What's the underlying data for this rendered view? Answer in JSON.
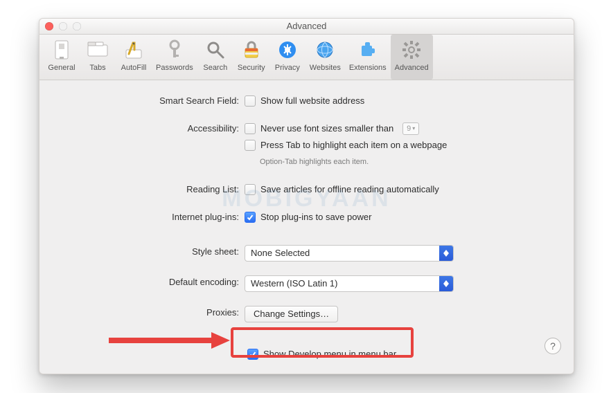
{
  "window": {
    "title": "Advanced"
  },
  "toolbar": {
    "items": [
      {
        "label": "General"
      },
      {
        "label": "Tabs"
      },
      {
        "label": "AutoFill"
      },
      {
        "label": "Passwords"
      },
      {
        "label": "Search"
      },
      {
        "label": "Security"
      },
      {
        "label": "Privacy"
      },
      {
        "label": "Websites"
      },
      {
        "label": "Extensions"
      },
      {
        "label": "Advanced"
      }
    ],
    "selected_index": 9
  },
  "panel": {
    "smart_search": {
      "label": "Smart Search Field:",
      "show_full_address": {
        "label": "Show full website address",
        "checked": false
      }
    },
    "accessibility": {
      "label": "Accessibility:",
      "never_smaller": {
        "label": "Never use font sizes smaller than",
        "checked": false,
        "value": "9"
      },
      "press_tab": {
        "label": "Press Tab to highlight each item on a webpage",
        "checked": false
      },
      "hint": "Option-Tab highlights each item."
    },
    "reading_list": {
      "label": "Reading List:",
      "save_offline": {
        "label": "Save articles for offline reading automatically",
        "checked": false
      }
    },
    "plugins": {
      "label": "Internet plug-ins:",
      "stop_power": {
        "label": "Stop plug-ins to save power",
        "checked": true
      }
    },
    "style_sheet": {
      "label": "Style sheet:",
      "value": "None Selected"
    },
    "default_encoding": {
      "label": "Default encoding:",
      "value": "Western (ISO Latin 1)"
    },
    "proxies": {
      "label": "Proxies:",
      "button": "Change Settings…"
    },
    "develop": {
      "label": "Show Develop menu in menu bar",
      "checked": true
    }
  },
  "watermark": "MOBIGYAAN",
  "help_glyph": "?"
}
